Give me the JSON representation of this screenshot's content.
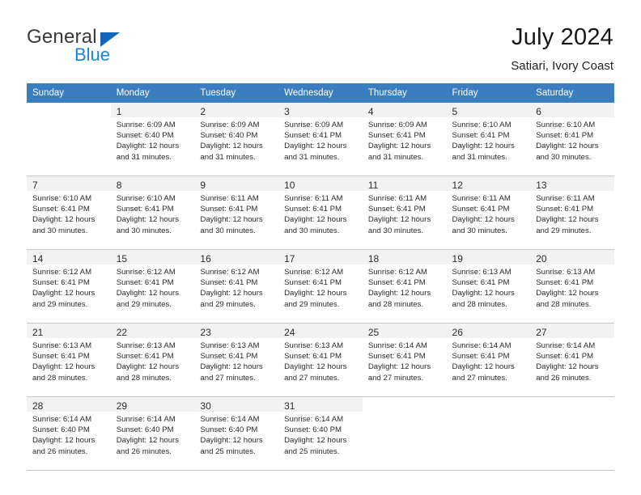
{
  "brand": {
    "name_top": "General",
    "name_bottom": "Blue",
    "triangle_color": "#1565b8",
    "blue_color": "#1a86d8"
  },
  "header": {
    "title": "July 2024",
    "subtitle": "Satiari, Ivory Coast"
  },
  "colors": {
    "header_row_bg": "#3a7ec0",
    "header_row_text": "#ffffff",
    "row_shade": "#f2f2f2",
    "grid_line": "#c8c8c8"
  },
  "weekdays": [
    "Sunday",
    "Monday",
    "Tuesday",
    "Wednesday",
    "Thursday",
    "Friday",
    "Saturday"
  ],
  "weeks": [
    {
      "shaded": true,
      "days": [
        {
          "empty": true
        },
        {
          "day": "1",
          "info": "Sunrise: 6:09 AM\nSunset: 6:40 PM\nDaylight: 12 hours\nand 31 minutes."
        },
        {
          "day": "2",
          "info": "Sunrise: 6:09 AM\nSunset: 6:40 PM\nDaylight: 12 hours\nand 31 minutes."
        },
        {
          "day": "3",
          "info": "Sunrise: 6:09 AM\nSunset: 6:41 PM\nDaylight: 12 hours\nand 31 minutes."
        },
        {
          "day": "4",
          "info": "Sunrise: 6:09 AM\nSunset: 6:41 PM\nDaylight: 12 hours\nand 31 minutes."
        },
        {
          "day": "5",
          "info": "Sunrise: 6:10 AM\nSunset: 6:41 PM\nDaylight: 12 hours\nand 31 minutes."
        },
        {
          "day": "6",
          "info": "Sunrise: 6:10 AM\nSunset: 6:41 PM\nDaylight: 12 hours\nand 30 minutes."
        }
      ]
    },
    {
      "shaded": true,
      "days": [
        {
          "day": "7",
          "info": "Sunrise: 6:10 AM\nSunset: 6:41 PM\nDaylight: 12 hours\nand 30 minutes."
        },
        {
          "day": "8",
          "info": "Sunrise: 6:10 AM\nSunset: 6:41 PM\nDaylight: 12 hours\nand 30 minutes."
        },
        {
          "day": "9",
          "info": "Sunrise: 6:11 AM\nSunset: 6:41 PM\nDaylight: 12 hours\nand 30 minutes."
        },
        {
          "day": "10",
          "info": "Sunrise: 6:11 AM\nSunset: 6:41 PM\nDaylight: 12 hours\nand 30 minutes."
        },
        {
          "day": "11",
          "info": "Sunrise: 6:11 AM\nSunset: 6:41 PM\nDaylight: 12 hours\nand 30 minutes."
        },
        {
          "day": "12",
          "info": "Sunrise: 6:11 AM\nSunset: 6:41 PM\nDaylight: 12 hours\nand 30 minutes."
        },
        {
          "day": "13",
          "info": "Sunrise: 6:11 AM\nSunset: 6:41 PM\nDaylight: 12 hours\nand 29 minutes."
        }
      ]
    },
    {
      "shaded": true,
      "days": [
        {
          "day": "14",
          "info": "Sunrise: 6:12 AM\nSunset: 6:41 PM\nDaylight: 12 hours\nand 29 minutes."
        },
        {
          "day": "15",
          "info": "Sunrise: 6:12 AM\nSunset: 6:41 PM\nDaylight: 12 hours\nand 29 minutes."
        },
        {
          "day": "16",
          "info": "Sunrise: 6:12 AM\nSunset: 6:41 PM\nDaylight: 12 hours\nand 29 minutes."
        },
        {
          "day": "17",
          "info": "Sunrise: 6:12 AM\nSunset: 6:41 PM\nDaylight: 12 hours\nand 29 minutes."
        },
        {
          "day": "18",
          "info": "Sunrise: 6:12 AM\nSunset: 6:41 PM\nDaylight: 12 hours\nand 28 minutes."
        },
        {
          "day": "19",
          "info": "Sunrise: 6:13 AM\nSunset: 6:41 PM\nDaylight: 12 hours\nand 28 minutes."
        },
        {
          "day": "20",
          "info": "Sunrise: 6:13 AM\nSunset: 6:41 PM\nDaylight: 12 hours\nand 28 minutes."
        }
      ]
    },
    {
      "shaded": true,
      "days": [
        {
          "day": "21",
          "info": "Sunrise: 6:13 AM\nSunset: 6:41 PM\nDaylight: 12 hours\nand 28 minutes."
        },
        {
          "day": "22",
          "info": "Sunrise: 6:13 AM\nSunset: 6:41 PM\nDaylight: 12 hours\nand 28 minutes."
        },
        {
          "day": "23",
          "info": "Sunrise: 6:13 AM\nSunset: 6:41 PM\nDaylight: 12 hours\nand 27 minutes."
        },
        {
          "day": "24",
          "info": "Sunrise: 6:13 AM\nSunset: 6:41 PM\nDaylight: 12 hours\nand 27 minutes."
        },
        {
          "day": "25",
          "info": "Sunrise: 6:14 AM\nSunset: 6:41 PM\nDaylight: 12 hours\nand 27 minutes."
        },
        {
          "day": "26",
          "info": "Sunrise: 6:14 AM\nSunset: 6:41 PM\nDaylight: 12 hours\nand 27 minutes."
        },
        {
          "day": "27",
          "info": "Sunrise: 6:14 AM\nSunset: 6:41 PM\nDaylight: 12 hours\nand 26 minutes."
        }
      ]
    },
    {
      "shaded": true,
      "days": [
        {
          "day": "28",
          "info": "Sunrise: 6:14 AM\nSunset: 6:40 PM\nDaylight: 12 hours\nand 26 minutes."
        },
        {
          "day": "29",
          "info": "Sunrise: 6:14 AM\nSunset: 6:40 PM\nDaylight: 12 hours\nand 26 minutes."
        },
        {
          "day": "30",
          "info": "Sunrise: 6:14 AM\nSunset: 6:40 PM\nDaylight: 12 hours\nand 25 minutes."
        },
        {
          "day": "31",
          "info": "Sunrise: 6:14 AM\nSunset: 6:40 PM\nDaylight: 12 hours\nand 25 minutes."
        },
        {
          "empty": true
        },
        {
          "empty": true
        },
        {
          "empty": true
        }
      ]
    }
  ]
}
